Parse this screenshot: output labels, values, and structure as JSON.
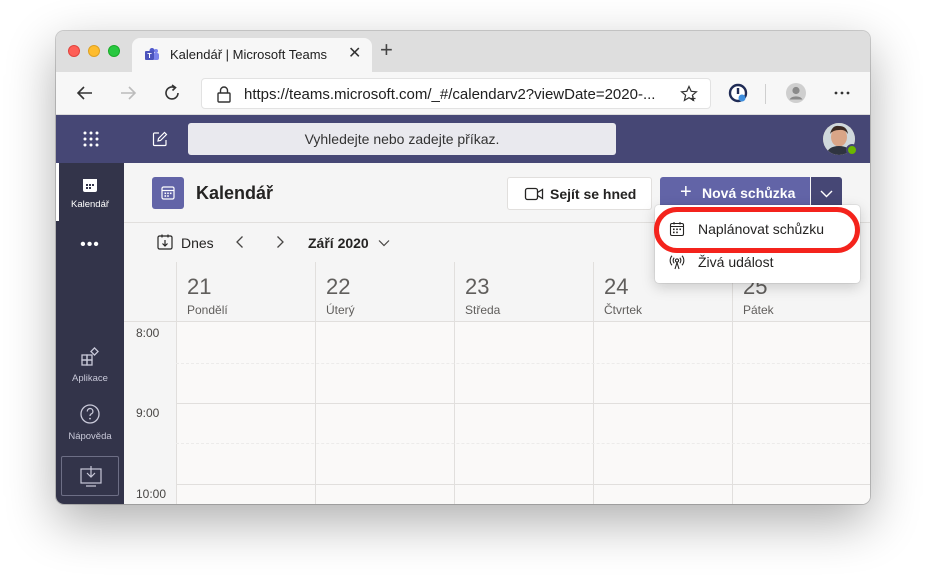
{
  "browser": {
    "tab_title": "Kalendář | Microsoft Teams",
    "tab_close": "✕",
    "new_tab": "+",
    "url": "https://teams.microsoft.com/_#/calendarv2?viewDate=2020-..."
  },
  "teams": {
    "search_placeholder": "Vyhledejte nebo zadejte příkaz."
  },
  "rail": {
    "items": [
      {
        "label": "Kalendář",
        "icon": "calendar-icon",
        "active": true
      },
      {
        "label": "",
        "icon": "more-dots-icon",
        "active": false
      },
      {
        "label": "Aplikace",
        "icon": "apps-icon",
        "active": false
      },
      {
        "label": "Nápověda",
        "icon": "help-icon",
        "active": false
      }
    ],
    "more_dots": "•••"
  },
  "calendar": {
    "title": "Kalendář",
    "meet_now_label": "Sejít se hned",
    "new_meeting_label": "Nová schůzka",
    "today_label": "Dnes",
    "month_label": "Září 2020",
    "days": [
      {
        "num": "21",
        "name": "Pondělí"
      },
      {
        "num": "22",
        "name": "Úterý"
      },
      {
        "num": "23",
        "name": "Středa"
      },
      {
        "num": "24",
        "name": "Čtvrtek"
      },
      {
        "num": "25",
        "name": "Pátek"
      }
    ],
    "times": [
      "8:00",
      "9:00",
      "10:00"
    ]
  },
  "menu": {
    "items": [
      {
        "label": "Naplánovat schůzku",
        "icon": "calendar-schedule-icon"
      },
      {
        "label": "Živá událost",
        "icon": "live-event-icon"
      }
    ]
  },
  "colors": {
    "teams_header": "#464775",
    "rail": "#33344a",
    "accent": "#6264a7",
    "highlight": "#f4231c"
  }
}
